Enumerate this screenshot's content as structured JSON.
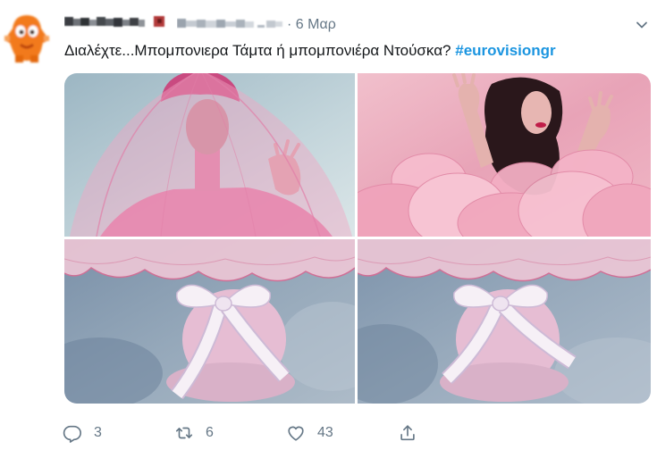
{
  "tweet": {
    "avatar_icon": "orange-monster-avatar",
    "date": "· 6 Μαρ",
    "text": "Διαλέχτε...Μπομπονιερα Τάμτα ή μπομπονιέρα Ντούσκα?",
    "hashtag": "#eurovisiongr",
    "menu_icon": "chevron-down-icon",
    "actions": {
      "reply": {
        "icon": "reply-icon",
        "count": "3"
      },
      "retweet": {
        "icon": "retweet-icon",
        "count": "6"
      },
      "like": {
        "icon": "heart-icon",
        "count": "43"
      },
      "share": {
        "icon": "share-icon"
      }
    }
  },
  "colors": {
    "text": "#14171a",
    "muted": "#657786",
    "link": "#1b95e0",
    "avatar": "#f27a1a"
  }
}
